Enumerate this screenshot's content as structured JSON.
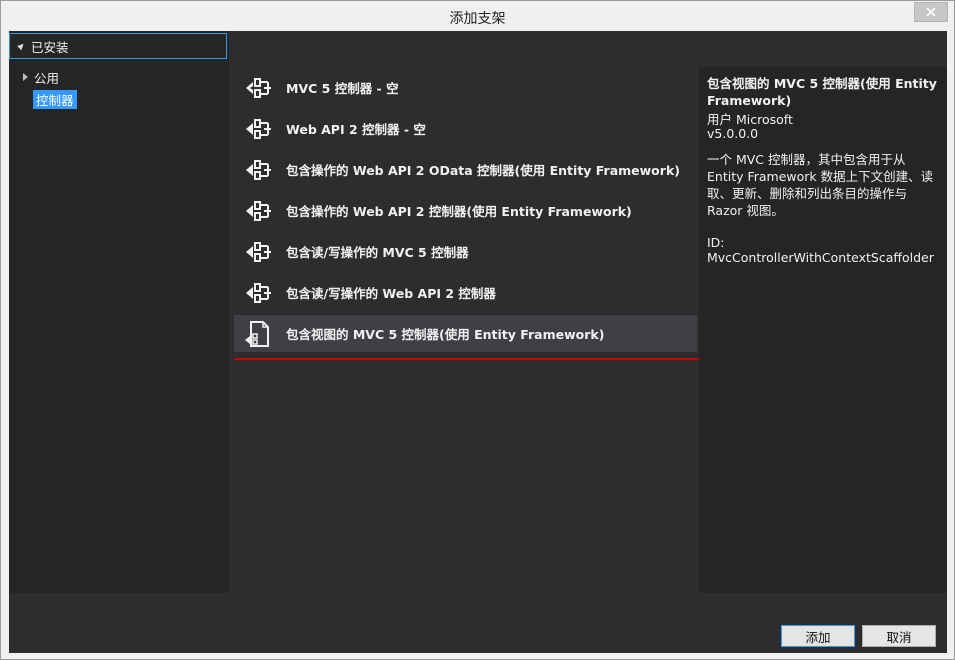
{
  "window": {
    "title": "添加支架"
  },
  "left": {
    "installed_label": "已安装",
    "tree": [
      {
        "label": "公用"
      },
      {
        "label": "控制器"
      }
    ]
  },
  "items": [
    {
      "label": "MVC 5 控制器 - 空",
      "icon": "controller-icon"
    },
    {
      "label": "Web API 2 控制器 - 空",
      "icon": "controller-icon"
    },
    {
      "label": "包含操作的 Web API 2 OData 控制器(使用 Entity Framework)",
      "icon": "controller-icon"
    },
    {
      "label": "包含操作的 Web API 2 控制器(使用 Entity Framework)",
      "icon": "controller-icon"
    },
    {
      "label": "包含读/写操作的 MVC 5 控制器",
      "icon": "controller-icon"
    },
    {
      "label": "包含读/写操作的 Web API 2 控制器",
      "icon": "controller-icon"
    },
    {
      "label": "包含视图的 MVC 5 控制器(使用 Entity Framework)",
      "icon": "controller-with-views-icon",
      "selected": true
    }
  ],
  "details": {
    "title": "包含视图的 MVC 5 控制器(使用 Entity Framework)",
    "author": "用户 Microsoft",
    "version": "v5.0.0.0",
    "description": "一个 MVC 控制器，其中包含用于从 Entity Framework 数据上下文创建、读取、更新、删除和列出条目的操作与 Razor 视图。",
    "id": "ID: MvcControllerWithContextScaffolder"
  },
  "buttons": {
    "add": "添加",
    "cancel": "取消"
  },
  "colors": {
    "accent": "#3399ff",
    "highlight_line": "#c50000",
    "background": "#2d2d30"
  }
}
